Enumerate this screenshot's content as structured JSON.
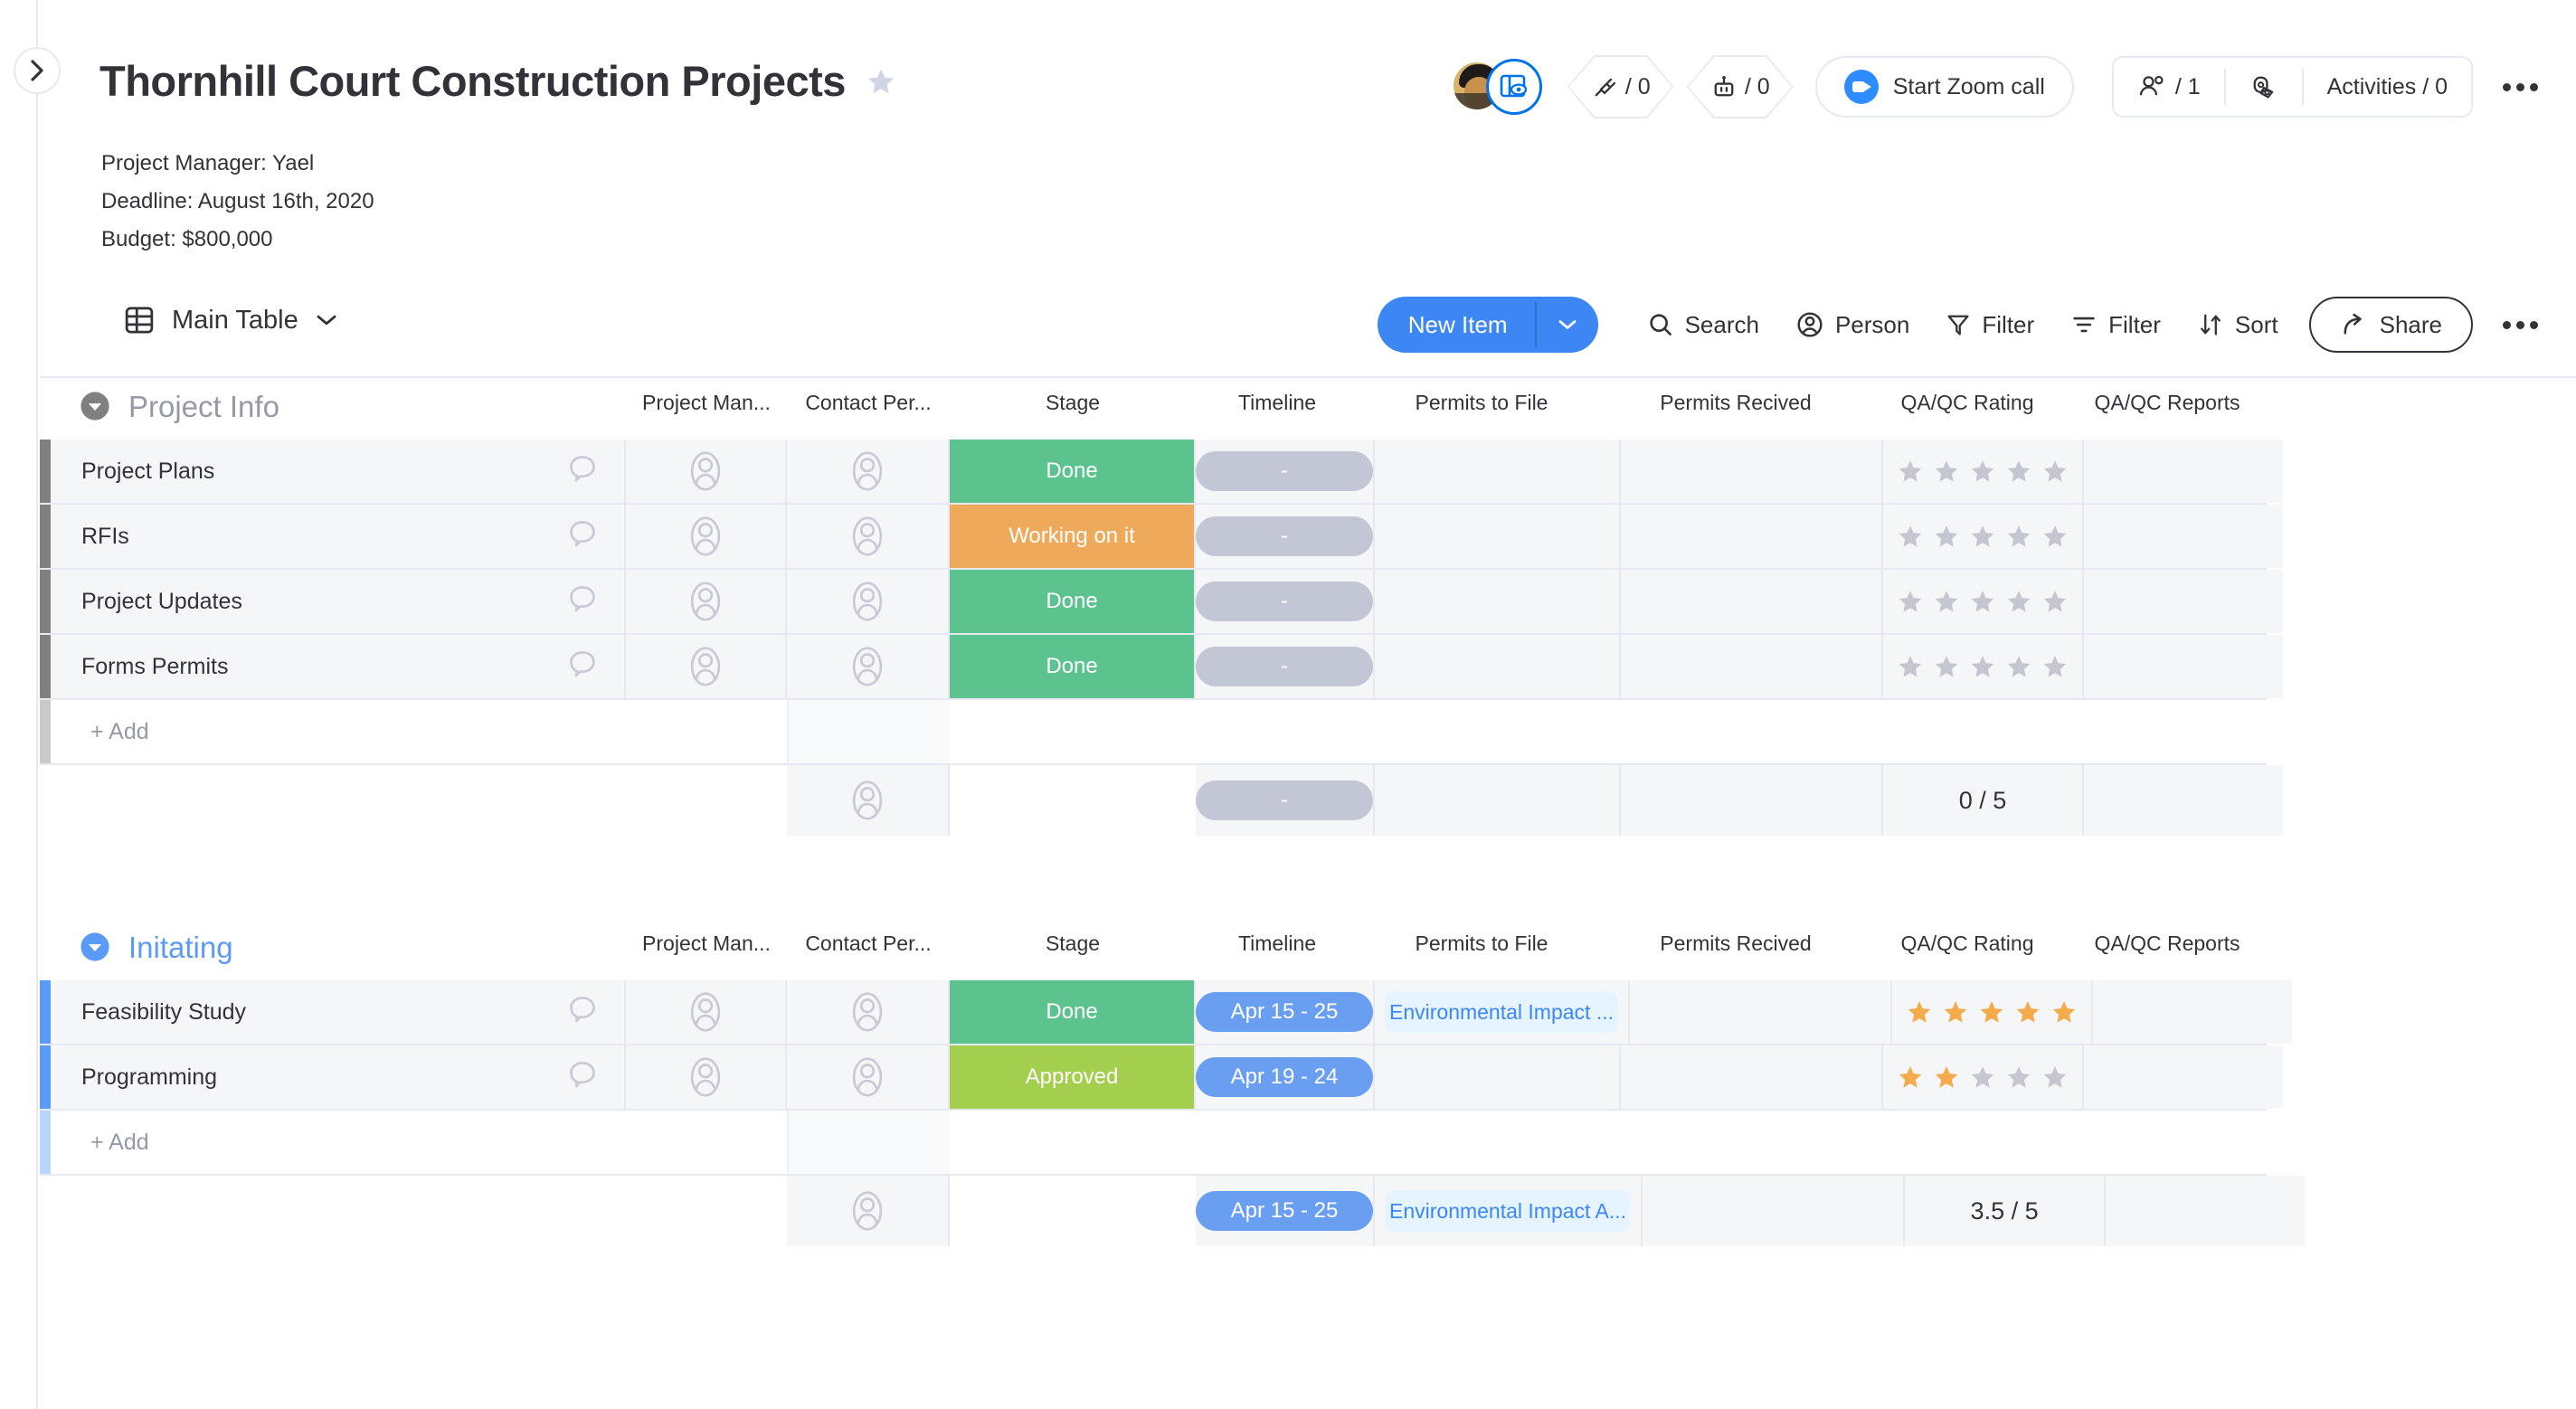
{
  "header": {
    "title": "Thornhill Court Construction Projects",
    "favorite_icon": "star-icon",
    "subtitle_lines": [
      "Project Manager: Yael",
      "Deadline: August 16th, 2020",
      "Budget: $800,000"
    ],
    "avatar_name": "board-owner-avatar",
    "view_badge_icon": "board-view-icon",
    "integrations": {
      "icon": "plug-icon",
      "label": "/ 0"
    },
    "automations": {
      "icon": "robot-icon",
      "label": "/ 0"
    },
    "zoom_call": {
      "label": "Start Zoom call",
      "icon": "zoom-camera-icon"
    },
    "invite": {
      "icon": "people-icon",
      "label": "/ 1"
    },
    "activity_log": {
      "icon": "log-icon"
    },
    "activities": {
      "label": "Activities / 0"
    },
    "more_menu": "..."
  },
  "toolbar": {
    "view_label": "Main Table",
    "view_icon": "table-icon",
    "view_caret": "chevron-down-icon",
    "new_item_label": "New Item",
    "search_label": "Search",
    "person_label": "Person",
    "filter_label": "Filter",
    "filter2_label": "Filter",
    "sort_label": "Sort",
    "share_label": "Share",
    "more_label": "..."
  },
  "columns": [
    "Project Man...",
    "Contact Per...",
    "Stage",
    "Timeline",
    "Permits to File",
    "Permits Recived",
    "QA/QC Rating",
    "QA/QC Reports"
  ],
  "colors": {
    "green": "#5cc28e",
    "orange": "#efa95a",
    "lime": "#a4ce4e",
    "blue": "#6a9ef0",
    "tag_bg": "#e5f4ff",
    "tag_text": "#3d87f5",
    "star_on": "#f5ab4c",
    "star_off": "#c5c7d0",
    "accent": "#0073ea",
    "group_gray": "#808080",
    "group_blue": "#5b9bf8"
  },
  "groups": [
    {
      "name": "Project Info",
      "color": "#808080",
      "title_color": "#9699a6",
      "collapse_icon": "collapse-arrow-icon",
      "add_label": "+ Add",
      "items": [
        {
          "name": "Project Plans",
          "stage": "Done",
          "stage_color": "#5cc28e",
          "timeline": "-",
          "timeline_color": "#c3c6d4",
          "permits_to_file": "",
          "permits_received": "",
          "rating": 0,
          "reports": ""
        },
        {
          "name": "RFIs",
          "stage": "Working on it",
          "stage_color": "#efa95a",
          "timeline": "-",
          "timeline_color": "#c3c6d4",
          "permits_to_file": "",
          "permits_received": "",
          "rating": 0,
          "reports": ""
        },
        {
          "name": "Project Updates",
          "stage": "Done",
          "stage_color": "#5cc28e",
          "timeline": "-",
          "timeline_color": "#c3c6d4",
          "permits_to_file": "",
          "permits_received": "",
          "rating": 0,
          "reports": ""
        },
        {
          "name": "Forms Permits",
          "stage": "Done",
          "stage_color": "#5cc28e",
          "timeline": "-",
          "timeline_color": "#c3c6d4",
          "permits_to_file": "",
          "permits_received": "",
          "rating": 0,
          "reports": ""
        }
      ],
      "summary": {
        "timeline": "-",
        "timeline_color": "#c3c6d4",
        "permits_to_file": "",
        "rating": "0 / 5"
      }
    },
    {
      "name": "Initating",
      "color": "#5b9bf8",
      "title_color": "#5b9bf8",
      "collapse_icon": "collapse-arrow-icon",
      "add_label": "+ Add",
      "items": [
        {
          "name": "Feasibility Study",
          "stage": "Done",
          "stage_color": "#5cc28e",
          "timeline": "Apr 15 - 25",
          "timeline_color": "#6a9ef0",
          "permits_to_file": "Environmental Impact ...",
          "permits_received": "",
          "rating": 5,
          "reports": ""
        },
        {
          "name": "Programming",
          "stage": "Approved",
          "stage_color": "#a4ce4e",
          "timeline": "Apr 19 - 24",
          "timeline_color": "#6a9ef0",
          "permits_to_file": "",
          "permits_received": "",
          "rating": 2,
          "reports": ""
        }
      ],
      "summary": {
        "timeline": "Apr 15 - 25",
        "timeline_color": "#6a9ef0",
        "permits_to_file": "Environmental Impact A...",
        "rating": "3.5 / 5"
      }
    }
  ]
}
